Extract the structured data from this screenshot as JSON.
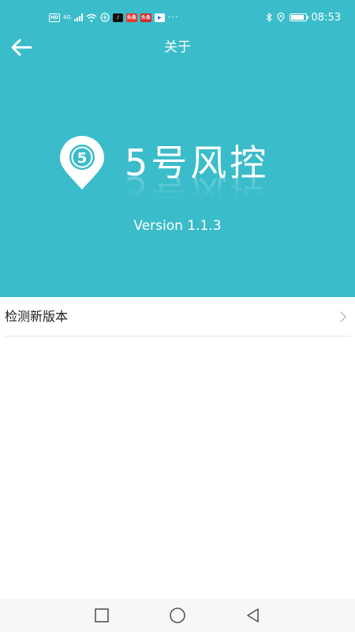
{
  "status_bar": {
    "hd_label": "HD",
    "network_label": "4G",
    "app_badges": [
      "♪",
      "头条",
      "头条",
      "▶"
    ],
    "more": "···",
    "time": "08:53",
    "battery_level": 0.9
  },
  "nav": {
    "title": "关于",
    "back_icon": "arrow-left-icon"
  },
  "brand": {
    "pin_number": "5",
    "name": "5号风控",
    "version": "Version 1.1.3"
  },
  "list": {
    "items": [
      {
        "label": "检测新版本",
        "icon": "chevron-right-icon"
      }
    ]
  },
  "system_nav": {
    "icons": [
      "recent-apps-icon",
      "home-icon",
      "back-icon"
    ]
  },
  "colors": {
    "header": "#3bbcca",
    "background": "#ffffff",
    "divider": "#e6e6e6"
  }
}
